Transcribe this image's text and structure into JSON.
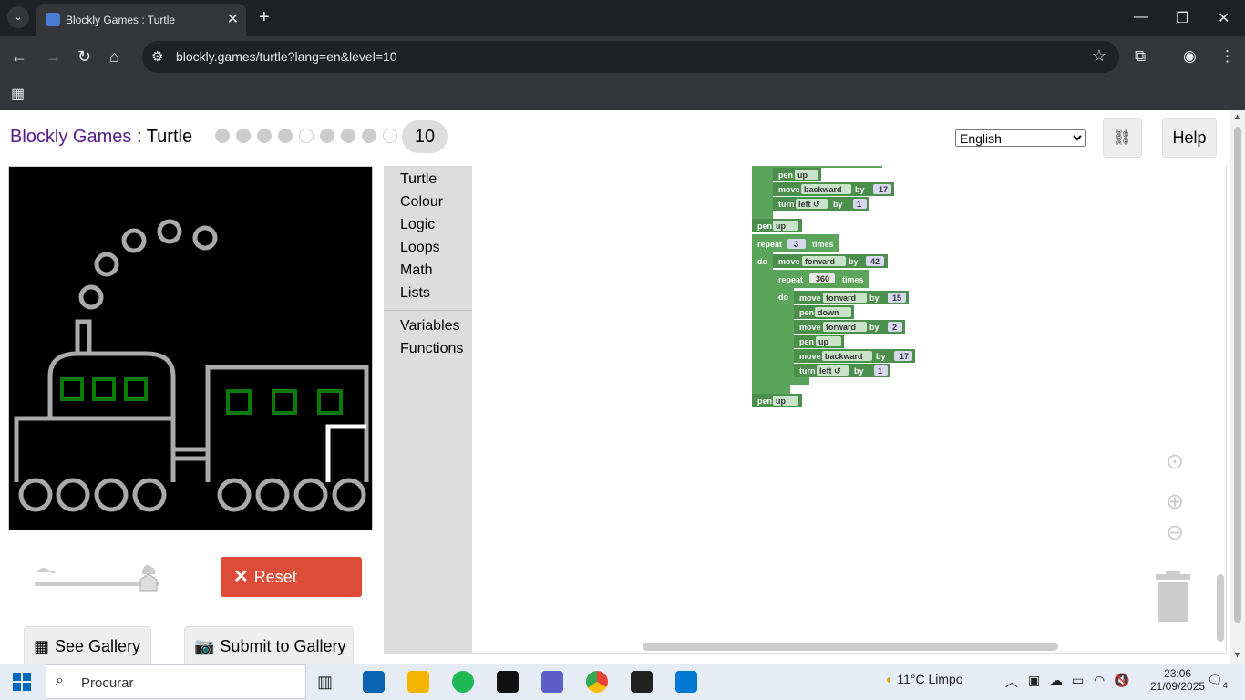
{
  "browser": {
    "tab_title": "Blockly Games : Turtle",
    "url": "blockly.games/turtle?lang=en&level=10",
    "new_tab": "+",
    "close_tab": "✕"
  },
  "page": {
    "brand": "Blockly Games",
    "separator": " : ",
    "game": "Turtle",
    "level": "10",
    "level_dots": [
      "done",
      "done",
      "done",
      "done",
      "empty",
      "done",
      "done",
      "done",
      "empty"
    ],
    "language": "English",
    "help_label": "Help",
    "reset_label": "Reset",
    "see_gallery_label": "See Gallery",
    "submit_gallery_label": "Submit to Gallery"
  },
  "toolbox": {
    "categories": [
      "Turtle",
      "Colour",
      "Logic",
      "Loops",
      "Math",
      "Lists"
    ],
    "dynamic": [
      "Variables",
      "Functions"
    ]
  },
  "blocks": {
    "pen": "pen",
    "up": "up",
    "down": "down",
    "move": "move",
    "forward": "forward",
    "backward": "backward",
    "by": "by",
    "turn": "turn",
    "left": "left ↺",
    "repeat": "repeat",
    "times": "times",
    "do": "do",
    "n17": "17",
    "n1": "1",
    "n3": "3",
    "n42": "42",
    "n360": "360",
    "n15": "15",
    "n2": "2"
  },
  "taskbar": {
    "search_placeholder": "Procurar",
    "weather": "11°C  Limpo",
    "time": "23:06",
    "date": "21/09/2025",
    "notif_count": "4"
  },
  "colors": {
    "block_green": "#5ba55b",
    "reset_red": "#dd4b39",
    "brand_purple": "#551a8b"
  }
}
